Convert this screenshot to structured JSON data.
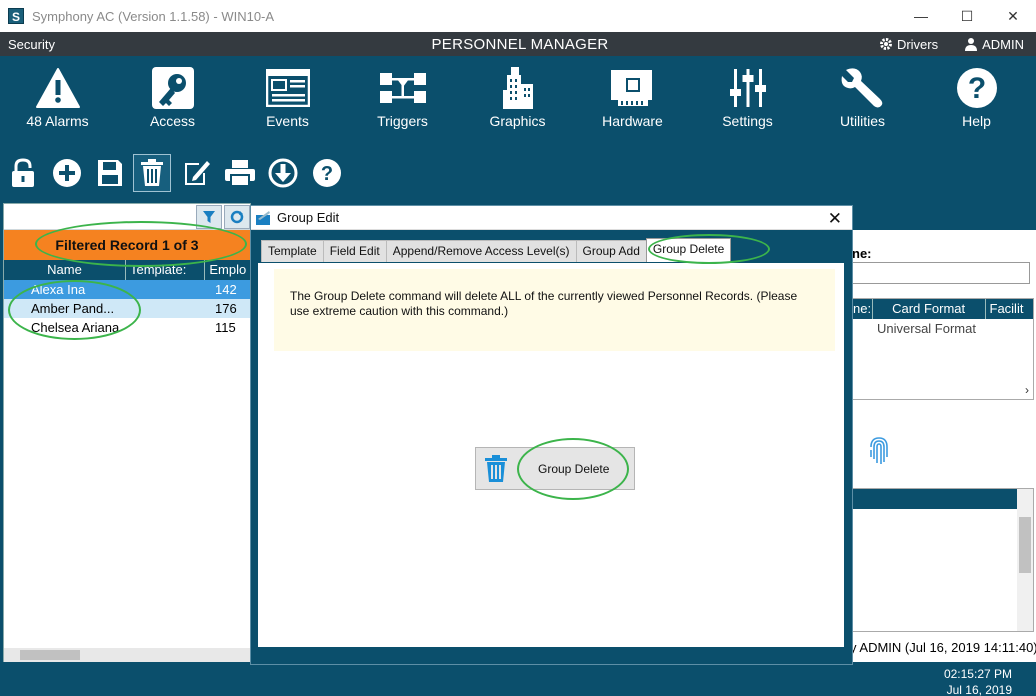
{
  "window": {
    "title": "Symphony AC  (Version 1.1.58) - WIN10-A",
    "app_icon": "S",
    "minimize": "—",
    "maximize": "☐",
    "close": "✕"
  },
  "header": {
    "left": "Security",
    "center": "PERSONNEL MANAGER",
    "drivers": "Drivers",
    "user": "ADMIN"
  },
  "nav": [
    {
      "label": "48 Alarms",
      "icon": "alarm-triangle-icon"
    },
    {
      "label": "Access",
      "icon": "access-key-icon"
    },
    {
      "label": "Events",
      "icon": "events-icon"
    },
    {
      "label": "Triggers",
      "icon": "triggers-icon"
    },
    {
      "label": "Graphics",
      "icon": "graphics-building-icon"
    },
    {
      "label": "Hardware",
      "icon": "hardware-board-icon"
    },
    {
      "label": "Settings",
      "icon": "settings-sliders-icon"
    },
    {
      "label": "Utilities",
      "icon": "utilities-wrench-icon"
    },
    {
      "label": "Help",
      "icon": "help-icon"
    }
  ],
  "toolbar": [
    "lock-icon",
    "add-icon",
    "save-icon",
    "delete-icon",
    "edit-icon",
    "print-icon",
    "download-icon",
    "help-icon"
  ],
  "left": {
    "filtered_label": "Filtered Record 1 of 3",
    "columns": [
      "Name",
      "Template:",
      "Emplo"
    ],
    "rows": [
      {
        "name": "Alexa Ina",
        "num": "142"
      },
      {
        "name": "Amber Pand...",
        "num": "176"
      },
      {
        "name": "Chelsea Ariana",
        "num": "115"
      }
    ]
  },
  "right": {
    "name_label": "ne:",
    "grid_columns": [
      "ne:",
      "Card Format",
      "Facilit"
    ],
    "grid_cell": "Universal Format",
    "status": "y ADMIN (Jul 16, 2019  14:11:40)"
  },
  "status": {
    "time": "02:15:27 PM",
    "date": "Jul 16, 2019"
  },
  "modal": {
    "title": "Group Edit",
    "close": "✕",
    "tabs": [
      "Template",
      "Field Edit",
      "Append/Remove Access Level(s)",
      "Group Add",
      "Group Delete"
    ],
    "active_tab": "Group Delete",
    "warning": "The Group Delete command will delete ALL of the currently viewed Personnel Records.  (Please use extreme caution with this command.)",
    "button_label": "Group Delete"
  },
  "colors": {
    "teal": "#0b4f6c",
    "orange": "#f58220",
    "selection": "#3c9be0",
    "annotation": "#3cb44b"
  }
}
